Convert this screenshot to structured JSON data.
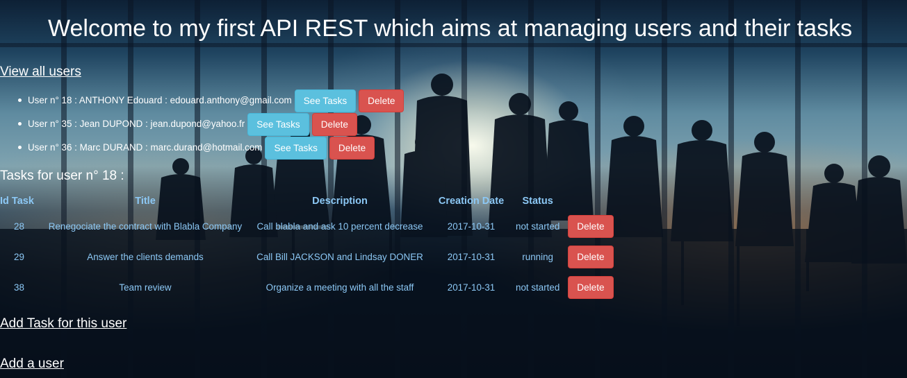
{
  "header": {
    "title": "Welcome to my first API REST which aims at managing users and their tasks"
  },
  "links": {
    "view_all_users": "View all users",
    "add_task": "Add Task for this user",
    "add_user": "Add a user"
  },
  "users": [
    {
      "text": "User n° 18 : ANTHONY Edouard : edouard.anthony@gmail.com",
      "see_tasks": "See Tasks",
      "delete": "Delete"
    },
    {
      "text": "User n° 35 : Jean DUPOND : jean.dupond@yahoo.fr",
      "see_tasks": "See Tasks",
      "delete": "Delete"
    },
    {
      "text": "User n° 36 : Marc DURAND : marc.durand@hotmail.com",
      "see_tasks": "See Tasks",
      "delete": "Delete"
    }
  ],
  "tasks_section": {
    "heading": "Tasks for user n° 18 :",
    "columns": [
      "Id Task",
      "Title",
      "Description",
      "Creation Date",
      "Status"
    ],
    "rows": [
      {
        "id": "28",
        "title": "Renegociate the contract with Blabla Company",
        "description": "Call blabla and ask 10 percent decrease",
        "date": "2017-10-31",
        "status": "not started",
        "delete": "Delete"
      },
      {
        "id": "29",
        "title": "Answer the clients demands",
        "description": "Call Bill JACKSON and Lindsay DONER",
        "date": "2017-10-31",
        "status": "running",
        "delete": "Delete"
      },
      {
        "id": "38",
        "title": "Team review",
        "description": "Organize a meeting with all the staff",
        "date": "2017-10-31",
        "status": "not started",
        "delete": "Delete"
      }
    ]
  },
  "colors": {
    "info_button": "#5bc0de",
    "danger_button": "#d9534f",
    "table_text": "#8cc8f5"
  }
}
